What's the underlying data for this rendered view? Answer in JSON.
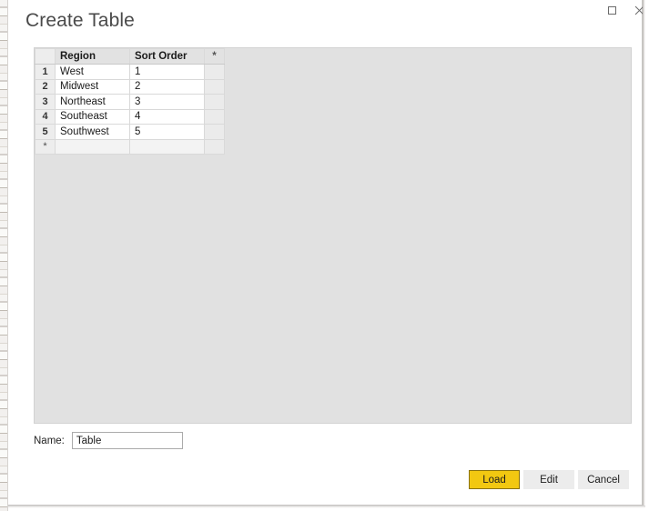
{
  "window": {
    "title": "Create Table",
    "controls": [
      {
        "name": "maximize",
        "glyph": "□"
      },
      {
        "name": "close",
        "glyph": "✕"
      }
    ]
  },
  "grid": {
    "columns": [
      "Region",
      "Sort Order"
    ],
    "new_column_marker": "*",
    "rows": [
      {
        "number": "1",
        "region": "West",
        "sort_order": "1"
      },
      {
        "number": "2",
        "region": "Midwest",
        "sort_order": "2"
      },
      {
        "number": "3",
        "region": "Northeast",
        "sort_order": "3"
      },
      {
        "number": "4",
        "region": "Southeast",
        "sort_order": "4"
      },
      {
        "number": "5",
        "region": "Southwest",
        "sort_order": "5"
      }
    ],
    "new_row_marker": "*"
  },
  "name_field": {
    "label": "Name:",
    "value": "Table",
    "placeholder": ""
  },
  "buttons": {
    "load": "Load",
    "edit": "Edit",
    "cancel": "Cancel"
  },
  "colors": {
    "accent_yellow": "#f2c811",
    "panel_gray": "#e1e1e1",
    "button_gray": "#ececec"
  }
}
